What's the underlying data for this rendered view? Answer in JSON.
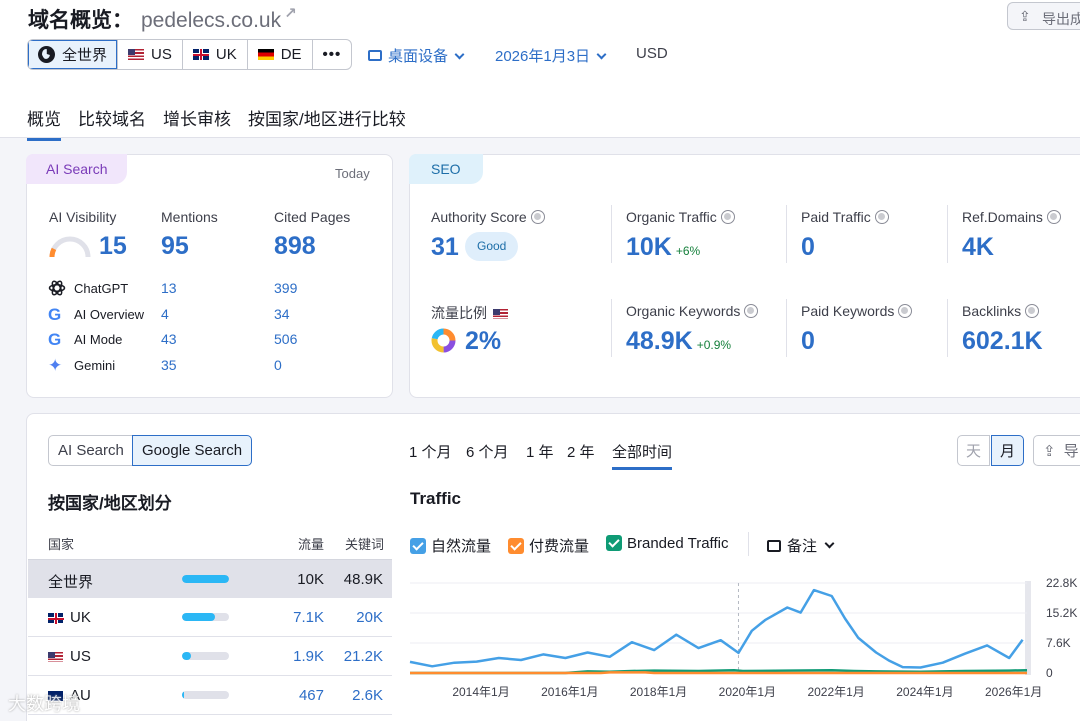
{
  "header": {
    "title": "域名概览：",
    "domain": "pedelecs.co.uk",
    "export_label": "导出成"
  },
  "regions": [
    {
      "label": "全世界",
      "flag": "globe",
      "active": true
    },
    {
      "label": "US",
      "flag": "us"
    },
    {
      "label": "UK",
      "flag": "uk"
    },
    {
      "label": "DE",
      "flag": "de"
    }
  ],
  "more_label": "•••",
  "device": "桌面设备",
  "date": "2026年1月3日",
  "currency": "USD",
  "tabs": [
    "概览",
    "比较域名",
    "增长审核",
    "按国家/地区进行比较"
  ],
  "ai_search": {
    "pill": "AI Search",
    "today": "Today",
    "visibility_label": "AI Visibility",
    "visibility": "15",
    "visibility_fraction": 0.15,
    "mentions_label": "Mentions",
    "mentions": "95",
    "cited_label": "Cited Pages",
    "cited": "898",
    "engines": [
      {
        "name": "ChatGPT",
        "icon": "chatgpt-icon",
        "mentions": "13",
        "cited": "399"
      },
      {
        "name": "AI Overview",
        "icon": "google-icon",
        "mentions": "4",
        "cited": "34"
      },
      {
        "name": "AI Mode",
        "icon": "google-icon",
        "mentions": "43",
        "cited": "506"
      },
      {
        "name": "Gemini",
        "icon": "gemini-icon",
        "mentions": "35",
        "cited": "0"
      }
    ]
  },
  "seo": {
    "pill": "SEO",
    "authority_label": "Authority Score",
    "authority": "31",
    "authority_badge": "Good",
    "organic_traffic_label": "Organic Traffic",
    "organic_traffic": "10K",
    "organic_traffic_delta": "+6%",
    "paid_traffic_label": "Paid Traffic",
    "paid_traffic": "0",
    "ref_domains_label": "Ref.Domains",
    "ref_domains": "4K",
    "share_label": "流量比例",
    "share": "2%",
    "organic_kw_label": "Organic Keywords",
    "organic_kw": "48.9K",
    "organic_kw_delta": "+0.9%",
    "paid_kw_label": "Paid Keywords",
    "paid_kw": "0",
    "backlinks_label": "Backlinks",
    "backlinks": "602.1K"
  },
  "search_toggle": [
    "AI Search",
    "Google Search"
  ],
  "ranges": [
    "1 个月",
    "6 个月",
    "1 年",
    "2 年",
    "全部时间"
  ],
  "granularity": [
    "天",
    "月"
  ],
  "export_small": "导",
  "country_section": {
    "title": "按国家/地区划分",
    "col_country": "国家",
    "col_traffic": "流量",
    "col_keywords": "关键词",
    "rows": [
      {
        "country": "全世界",
        "flag": "none",
        "traffic": "10K",
        "keywords": "48.9K",
        "share": 1.0
      },
      {
        "country": "UK",
        "flag": "uk",
        "traffic": "7.1K",
        "keywords": "20K",
        "share": 0.71
      },
      {
        "country": "US",
        "flag": "us",
        "traffic": "1.9K",
        "keywords": "21.2K",
        "share": 0.19
      },
      {
        "country": "AU",
        "flag": "au",
        "traffic": "467",
        "keywords": "2.6K",
        "share": 0.05
      }
    ]
  },
  "traffic_section": {
    "title": "Traffic",
    "legend": [
      {
        "label": "自然流量",
        "color": "#45a0e6"
      },
      {
        "label": "付费流量",
        "color": "#ff8c2f"
      },
      {
        "label": "Branded Traffic",
        "color": "#0f9b75"
      }
    ],
    "notes_label": "备注"
  },
  "chart_data": {
    "type": "line",
    "title": "Traffic",
    "xlabel": "",
    "ylabel": "",
    "x_ticks": [
      "2014年1月",
      "2016年1月",
      "2018年1月",
      "2020年1月",
      "2022年1月",
      "2024年1月",
      "2026年1月"
    ],
    "y_ticks": [
      "0",
      "7.6K",
      "15.2K",
      "22.8K"
    ],
    "ylim": [
      0,
      22800
    ],
    "x_range": [
      2012.5,
      2026.4
    ],
    "series": [
      {
        "name": "自然流量",
        "color": "#45a0e6",
        "x": [
          2012.5,
          2013.0,
          2013.5,
          2014.0,
          2014.5,
          2015.0,
          2015.5,
          2016.0,
          2016.5,
          2017.0,
          2017.5,
          2018.0,
          2018.5,
          2019.0,
          2019.5,
          2019.9,
          2020.2,
          2020.5,
          2021.0,
          2021.3,
          2021.6,
          2022.0,
          2022.3,
          2022.6,
          2023.0,
          2023.3,
          2023.6,
          2024.0,
          2024.5,
          2025.0,
          2025.5,
          2026.0,
          2026.3
        ],
        "y": [
          2800,
          1700,
          2600,
          2900,
          3800,
          3300,
          4700,
          3800,
          5200,
          4100,
          7800,
          5800,
          9700,
          6300,
          8300,
          5100,
          10700,
          13400,
          16600,
          15300,
          21000,
          19500,
          13800,
          8900,
          5200,
          3100,
          1500,
          1400,
          2600,
          4900,
          7000,
          3800,
          8400
        ]
      },
      {
        "name": "付费流量",
        "color": "#ff8c2f",
        "x": [
          2012.5,
          2016.8,
          2017.0,
          2017.8,
          2018.0,
          2026.4
        ],
        "y": [
          0,
          0,
          150,
          150,
          0,
          0
        ]
      },
      {
        "name": "Branded Traffic",
        "color": "#0f9b75",
        "x": [
          2012.5,
          2016.0,
          2016.5,
          2017.0,
          2017.5,
          2018.0,
          2019.0,
          2019.8,
          2020.0,
          2021.0,
          2022.0,
          2022.5,
          2023.0,
          2024.0,
          2025.0,
          2026.0,
          2026.4
        ],
        "y": [
          0,
          0,
          400,
          300,
          500,
          600,
          500,
          700,
          500,
          600,
          700,
          500,
          400,
          300,
          500,
          600,
          700
        ]
      }
    ]
  },
  "watermark": "大数跨境"
}
